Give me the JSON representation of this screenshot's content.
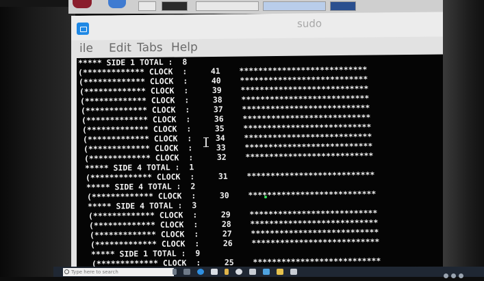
{
  "window": {
    "title": "sudo",
    "menu": [
      "ile",
      "Edit",
      "Tabs",
      "Help"
    ]
  },
  "terminal": {
    "lines": [
      "***** SIDE 1 TOTAL :  8",
      "(************* CLOCK  :     41    ***************************",
      "(************* CLOCK  :     40    ***************************",
      "(************* CLOCK  :     39    ***************************",
      "(************* CLOCK  :     38    ***************************",
      "(************* CLOCK  :     37    ***************************",
      "(************* CLOCK  :     36    ***************************",
      "(************* CLOCK  :     35    ***************************",
      "(************* CLOCK  :     34    ***************************",
      "(************* CLOCK  :     33    ***************************",
      "(************* CLOCK  :     32    ***************************",
      "***** SIDE 4 TOTAL :  1",
      "(************* CLOCK  :     31    ***************************",
      "***** SIDE 4 TOTAL :  2",
      "(************* CLOCK  :     30    ***************************",
      "***** SIDE 4 TOTAL :  3",
      "(************* CLOCK  :     29    ***************************",
      "(************* CLOCK  :     28    ***************************",
      "(************* CLOCK  :     27    ***************************",
      "(************* CLOCK  :     26    ***************************",
      "***** SIDE 1 TOTAL :  9",
      "(************* CLOCK  :     25    ***************************"
    ]
  },
  "taskbar": {
    "search_placeholder": "Type here to search"
  },
  "colors": {
    "terminal_bg": "#050505",
    "terminal_fg": "#f2f2f2",
    "accent": "#1e88e5",
    "taskbar": "#1f2733"
  }
}
